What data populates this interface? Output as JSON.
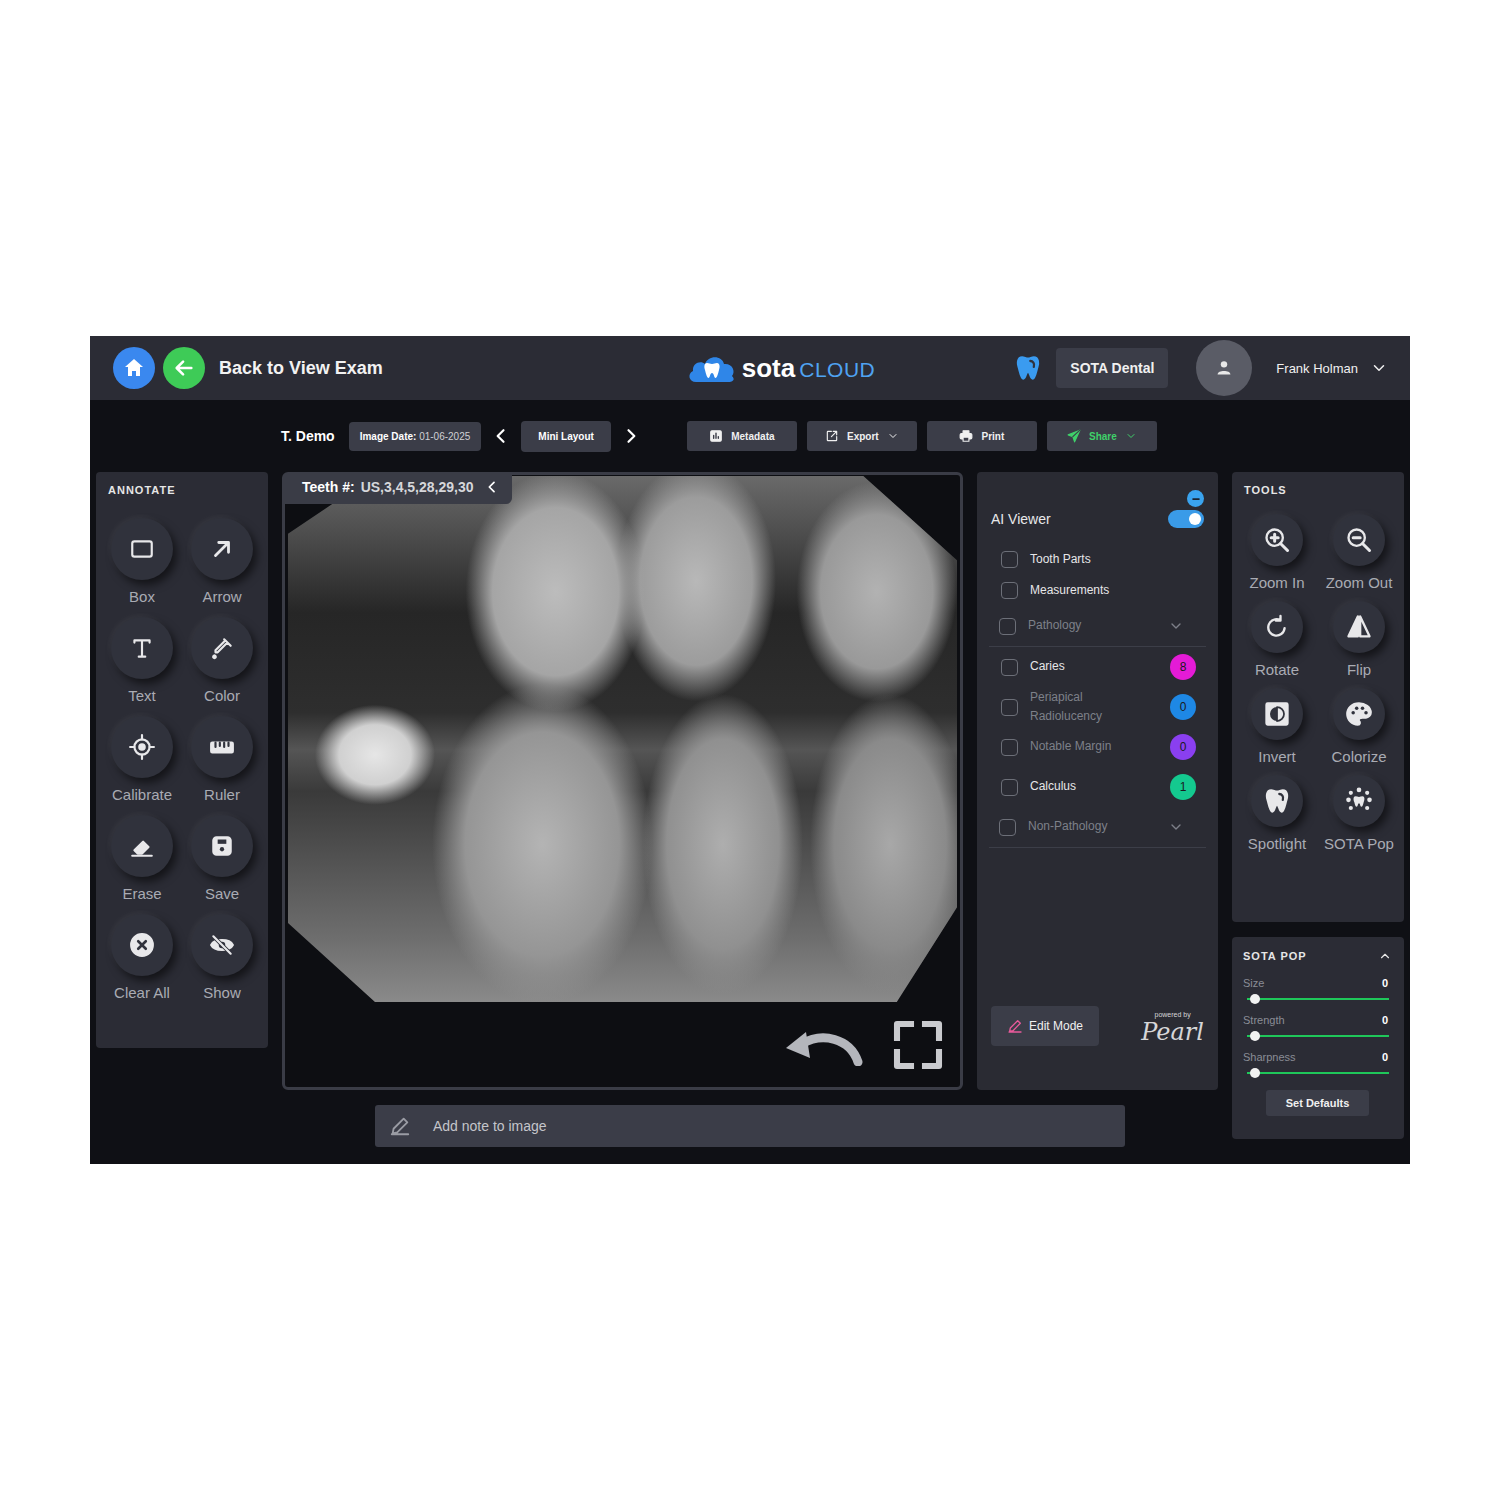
{
  "header": {
    "back_label": "Back to View Exam",
    "logo": {
      "bold": "sota",
      "light": "CLOUD"
    },
    "practice": "SOTA Dental",
    "user": "Frank Holman"
  },
  "toolbar": {
    "patient": "T. Demo",
    "image_date_label": "Image Date:",
    "image_date": "01-06-2025",
    "layout": "Mini Layout",
    "buttons": [
      {
        "label": "Metadata",
        "dropdown": false,
        "primary": false
      },
      {
        "label": "Export",
        "dropdown": true,
        "primary": false
      },
      {
        "label": "Print",
        "dropdown": false,
        "primary": false
      },
      {
        "label": "Share",
        "dropdown": true,
        "primary": true
      }
    ]
  },
  "annotate": {
    "title": "ANNOTATE",
    "tools": [
      "Box",
      "Arrow",
      "Text",
      "Color",
      "Calibrate",
      "Ruler",
      "Erase",
      "Save",
      "Clear All",
      "Show"
    ]
  },
  "image_panel": {
    "teeth_label": "Teeth #:",
    "teeth": "US,3,4,5,28,29,30"
  },
  "ai_panel": {
    "title": "AI Viewer",
    "enabled": true,
    "items": [
      {
        "kind": "check",
        "label": "Tooth Parts",
        "checked": false,
        "disabled": false
      },
      {
        "kind": "check",
        "label": "Measurements",
        "checked": false,
        "disabled": false
      },
      {
        "kind": "group",
        "label": "Pathology",
        "checked": false,
        "disabled": true,
        "expanded": false
      },
      {
        "kind": "count",
        "label": "Caries",
        "checked": false,
        "disabled": false,
        "count": "8",
        "color": "#e41bd6"
      },
      {
        "kind": "count",
        "label": "Periapical Radiolucency",
        "checked": false,
        "disabled": true,
        "count": "0",
        "color": "#1e88e5"
      },
      {
        "kind": "count",
        "label": "Notable Margin",
        "checked": false,
        "disabled": true,
        "count": "0",
        "color": "#8a3ff0"
      },
      {
        "kind": "count",
        "label": "Calculus",
        "checked": false,
        "disabled": false,
        "count": "1",
        "color": "#14c98f"
      },
      {
        "kind": "group",
        "label": "Non-Pathology",
        "checked": false,
        "disabled": true,
        "expanded": false
      }
    ],
    "edit_button": "Edit Mode",
    "powered_by": "powered by",
    "brand": "Pearl"
  },
  "tools": {
    "title": "TOOLS",
    "items": [
      "Zoom In",
      "Zoom Out",
      "Rotate",
      "Flip",
      "Invert",
      "Colorize",
      "Spotlight",
      "SOTA Pop"
    ]
  },
  "sota_pop": {
    "title": "SOTA POP",
    "expanded": true,
    "sliders": [
      {
        "label": "Size",
        "reading": "0",
        "level": 0
      },
      {
        "label": "Strength",
        "reading": "0",
        "level": 0
      },
      {
        "label": "Sharpness",
        "reading": "0",
        "level": 0
      }
    ],
    "button": "Set Defaults"
  },
  "note": {
    "placeholder": "Add note to image"
  }
}
